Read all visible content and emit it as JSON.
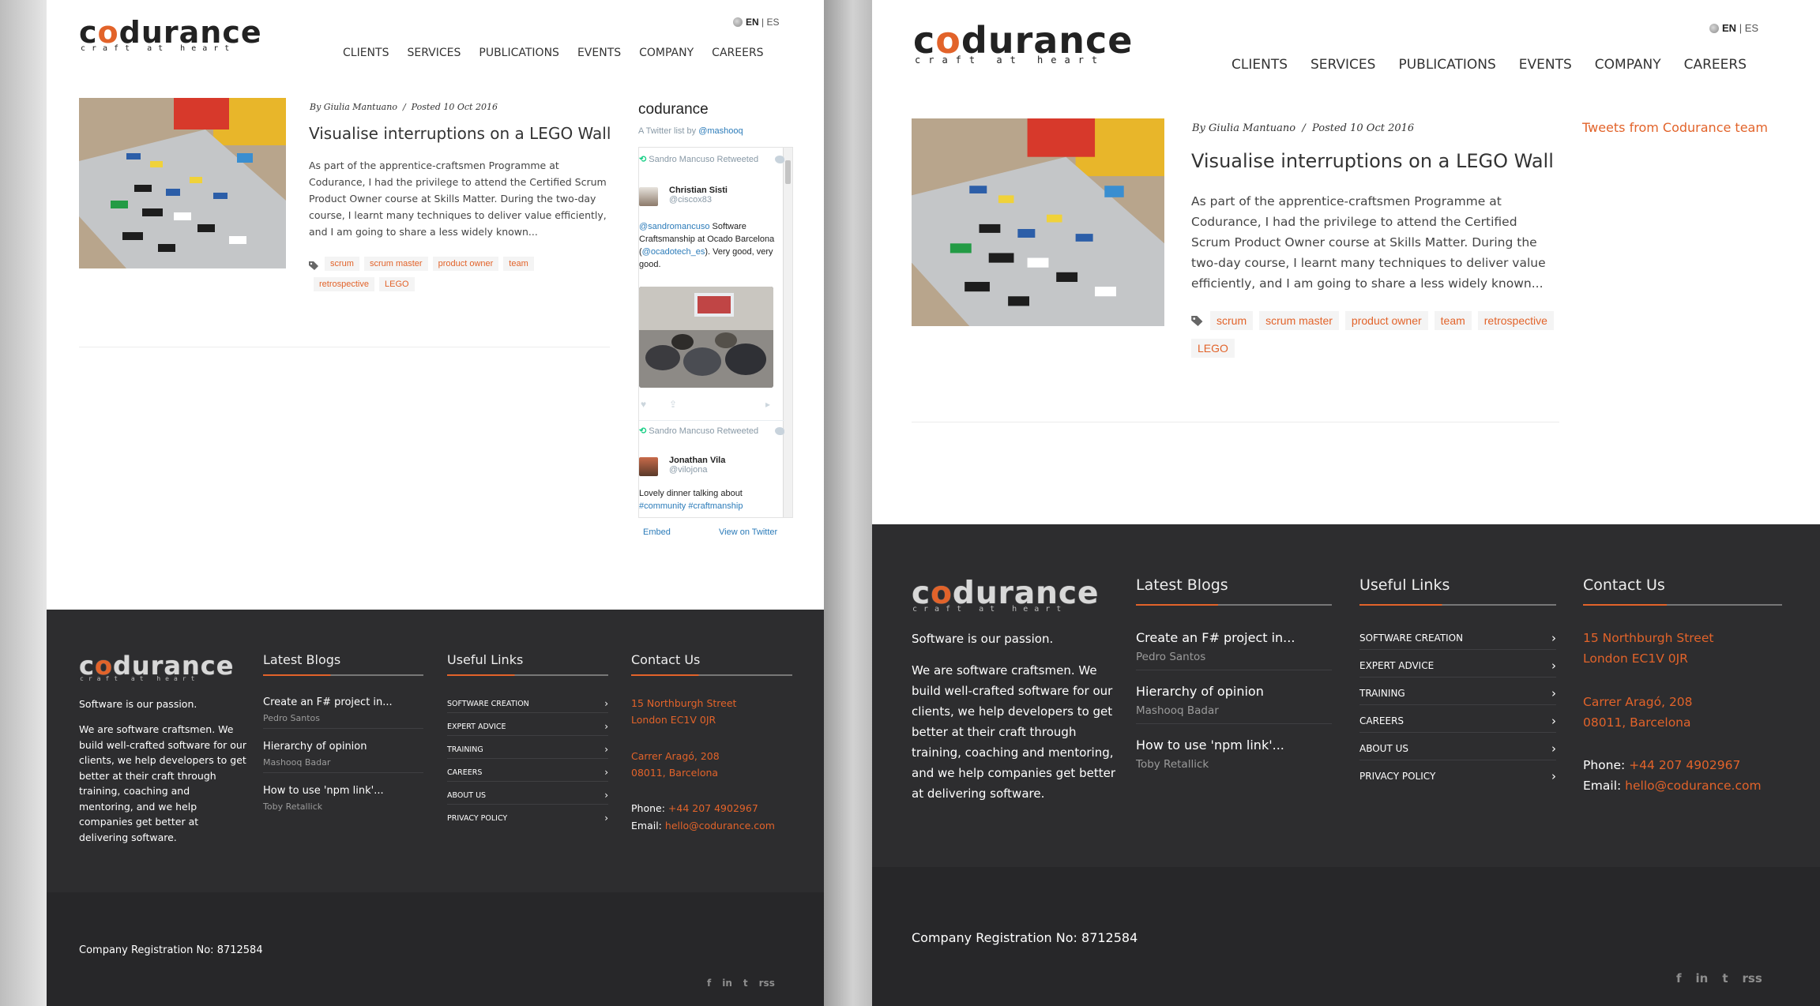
{
  "site": {
    "logo_text_pre": "c",
    "logo_text_o": "o",
    "logo_text_post": "durance",
    "logo_tagline": "craft at heart",
    "lang_en": "EN",
    "lang_sep": "|",
    "lang_es": "ES",
    "nav": [
      "CLIENTS",
      "SERVICES",
      "PUBLICATIONS",
      "EVENTS",
      "COMPANY",
      "CAREERS"
    ]
  },
  "post": {
    "author": "By Giulia Mantuano",
    "sep": "/",
    "date": "Posted 10 Oct 2016",
    "title": "Visualise interruptions on a LEGO Wall",
    "excerpt": "As part of the apprentice-craftsmen Programme at Codurance, I had the privilege to attend the Certified Scrum Product Owner course at Skills Matter. During the two-day course, I learnt many techniques to deliver value efficiently, and I am going to share a less widely known...",
    "tags": [
      "scrum",
      "scrum master",
      "product owner",
      "team",
      "retrospective",
      "LEGO"
    ]
  },
  "twitter": {
    "title": "codurance",
    "subtitle_pre": "A Twitter list by ",
    "subtitle_link": "@mashooq",
    "tweets": [
      {
        "retweet": "Sandro Mancuso Retweeted",
        "name": "Christian Sisti",
        "handle": "@ciscox83",
        "text_link1": "@sandromancuso",
        "text_mid": " Software Craftsmanship at Ocado Barcelona (",
        "text_link2": "@ocadotech_es",
        "text_end": "). Very good, very good."
      },
      {
        "retweet": "Sandro Mancuso Retweeted",
        "name": "Jonathan Vila",
        "handle": "@vilojona",
        "text": "Lovely dinner talking about",
        "text_links": "#community #craftmanship"
      }
    ],
    "embed": "Embed",
    "view": "View on Twitter",
    "right_link": "Tweets from Codurance team"
  },
  "footer": {
    "passion": "Software is our passion.",
    "about": "We are software craftsmen. We build well-crafted software for our clients, we help developers to get better at their craft through training, coaching and mentoring, and we help companies get better at delivering software.",
    "latest_head": "Latest Blogs",
    "blogs": [
      {
        "title": "Create an F# project in...",
        "author": "Pedro Santos"
      },
      {
        "title": "Hierarchy of opinion",
        "author": "Mashooq Badar"
      },
      {
        "title": "How to use 'npm link'...",
        "author": "Toby Retallick"
      }
    ],
    "links_head": "Useful Links",
    "links": [
      "Software Creation",
      "Expert Advice",
      "Training",
      "Careers",
      "About Us",
      "Privacy Policy"
    ],
    "contact_head": "Contact Us",
    "addr1_l1": "15 Northburgh Street",
    "addr1_l2": "London EC1V 0JR",
    "addr2_l1": "Carrer Aragó, 208",
    "addr2_l2": "08011, Barcelona",
    "phone_label": "Phone:",
    "phone": "+44 207 4902967",
    "email_label": "Email:",
    "email": "hello@codurance.com",
    "registration": "Company Registration No: 8712584",
    "social": [
      "f",
      "in",
      "t",
      "rss"
    ]
  },
  "colors": {
    "accent": "#e2632a",
    "footer_bg": "#2d2d2f",
    "footer_bottom": "#272729"
  }
}
